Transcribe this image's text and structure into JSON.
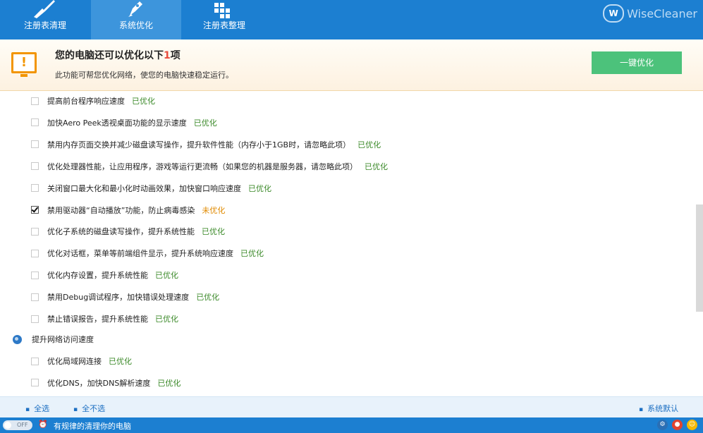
{
  "tabs": [
    {
      "label": "注册表清理",
      "icon": "broom-icon"
    },
    {
      "label": "系统优化",
      "icon": "rocket-icon"
    },
    {
      "label": "注册表整理",
      "icon": "blocks-icon"
    }
  ],
  "brand": {
    "logo": "W",
    "name": "WiseCleaner"
  },
  "notice": {
    "title_prefix": "您的电脑还可以优化以下",
    "count": "1",
    "title_suffix": "项",
    "description": "此功能可帮您优化网络，使您的电脑快速稳定运行。",
    "button": "一键优化"
  },
  "items_system": [
    {
      "label": "提高前台程序响应速度",
      "status": "已优化",
      "checked": false
    },
    {
      "label": "加快Aero Peek透视桌面功能的显示速度",
      "status": "已优化",
      "checked": false
    },
    {
      "label": "禁用内存页面交换并减少磁盘读写操作，提升软件性能（内存小于1GB时，请忽略此项）",
      "status": "已优化",
      "checked": false
    },
    {
      "label": "优化处理器性能，让应用程序，游戏等运行更流畅（如果您的机器是服务器，请忽略此项）",
      "status": "已优化",
      "checked": false
    },
    {
      "label": "关闭窗口最大化和最小化时动画效果，加快窗口响应速度",
      "status": "已优化",
      "checked": false
    },
    {
      "label": "禁用驱动器“自动播放”功能，防止病毒感染",
      "status": "未优化",
      "checked": true
    },
    {
      "label": "优化子系统的磁盘读写操作，提升系统性能",
      "status": "已优化",
      "checked": false
    },
    {
      "label": "优化对话框，菜单等前端组件显示，提升系统响应速度",
      "status": "已优化",
      "checked": false
    },
    {
      "label": "优化内存设置，提升系统性能",
      "status": "已优化",
      "checked": false
    },
    {
      "label": "禁用Debug调试程序，加快错误处理速度",
      "status": "已优化",
      "checked": false
    },
    {
      "label": "禁止错误报告，提升系统性能",
      "status": "已优化",
      "checked": false
    }
  ],
  "network_section": {
    "title": "提升网络访问速度",
    "icon": "globe-icon"
  },
  "items_network": [
    {
      "label": "优化局域网连接",
      "status": "已优化",
      "checked": false
    },
    {
      "label": "优化DNS，加快DNS解析速度",
      "status": "已优化",
      "checked": false
    }
  ],
  "footer": {
    "select_all": "全选",
    "select_none": "全不选",
    "default": "系统默认"
  },
  "statusbar": {
    "toggle": "OFF",
    "text": "有规律的清理你的电脑"
  },
  "colors": {
    "primary": "#1c7fd1",
    "ok": "#3c8a2a",
    "pending": "#e08a00",
    "button": "#4cc27b",
    "warning": "#f29500"
  }
}
